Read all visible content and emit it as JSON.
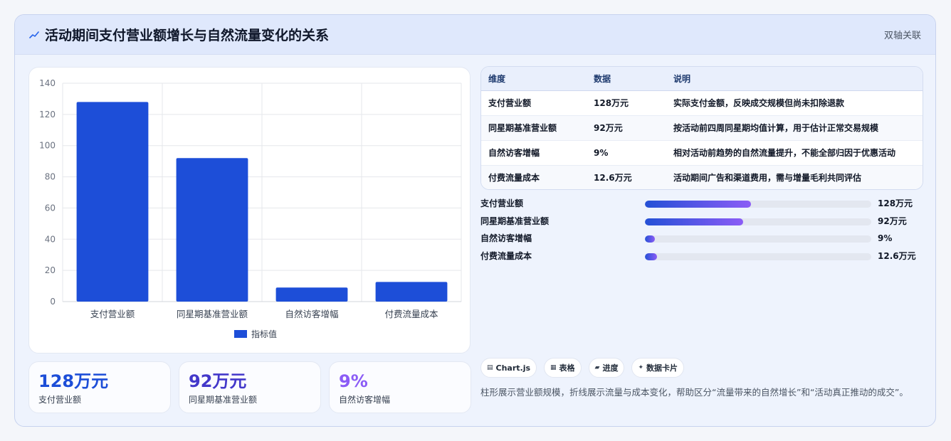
{
  "header": {
    "title": "活动期间支付营业额增长与自然流量变化的关系",
    "tag": "双轴关联",
    "icon": "trend-line-icon",
    "accent": "#2563eb"
  },
  "chart_data": {
    "type": "bar",
    "categories": [
      "支付营业额",
      "同星期基准营业额",
      "自然访客增幅",
      "付费流量成本"
    ],
    "series": [
      {
        "name": "指标值",
        "values": [
          128,
          92,
          9,
          12.6
        ],
        "color": "#1d4ed8"
      }
    ],
    "ylim": [
      0,
      140
    ],
    "yticks": [
      0,
      20,
      40,
      60,
      80,
      100,
      120,
      140
    ],
    "grid": true,
    "legend": "bottom"
  },
  "kpis": [
    {
      "value": "128万元",
      "label": "支付营业额",
      "color": "#1d4ed8"
    },
    {
      "value": "92万元",
      "label": "同星期基准营业额",
      "color": "#4338ca"
    },
    {
      "value": "9%",
      "label": "自然访客增幅",
      "color": "#8b5cf6"
    }
  ],
  "table": {
    "headers": [
      "维度",
      "数据",
      "说明"
    ],
    "rows": [
      {
        "dimension": "支付营业额",
        "value": "128万元",
        "desc": "实际支付金额，反映成交规模但尚未扣除退款"
      },
      {
        "dimension": "同星期基准营业额",
        "value": "92万元",
        "desc": "按活动前四周同星期均值计算，用于估计正常交易规模"
      },
      {
        "dimension": "自然访客增幅",
        "value": "9%",
        "desc": "相对活动前趋势的自然流量提升，不能全部归因于优惠活动"
      },
      {
        "dimension": "付费流量成本",
        "value": "12.6万元",
        "desc": "活动期间广告和渠道费用，需与增量毛利共同评估"
      }
    ]
  },
  "progress": [
    {
      "label": "支付营业额",
      "value": "128万元",
      "fraction": 0.47
    },
    {
      "label": "同星期基准营业额",
      "value": "92万元",
      "fraction": 0.435
    },
    {
      "label": "自然访客增幅",
      "value": "9%",
      "fraction": 0.045
    },
    {
      "label": "付费流量成本",
      "value": "12.6万元",
      "fraction": 0.055
    }
  ],
  "chips": [
    {
      "icon": "chart-icon",
      "glyph": "▤",
      "label": "Chart.js"
    },
    {
      "icon": "table-icon",
      "glyph": "▦",
      "label": "表格"
    },
    {
      "icon": "progress-icon",
      "glyph": "▰",
      "label": "进度"
    },
    {
      "icon": "sparkle-icon",
      "glyph": "✦",
      "label": "数据卡片"
    }
  ],
  "note": "柱形展示营业额规模，折线展示流量与成本变化，帮助区分“流量带来的自然增长”和“活动真正推动的成交”。"
}
